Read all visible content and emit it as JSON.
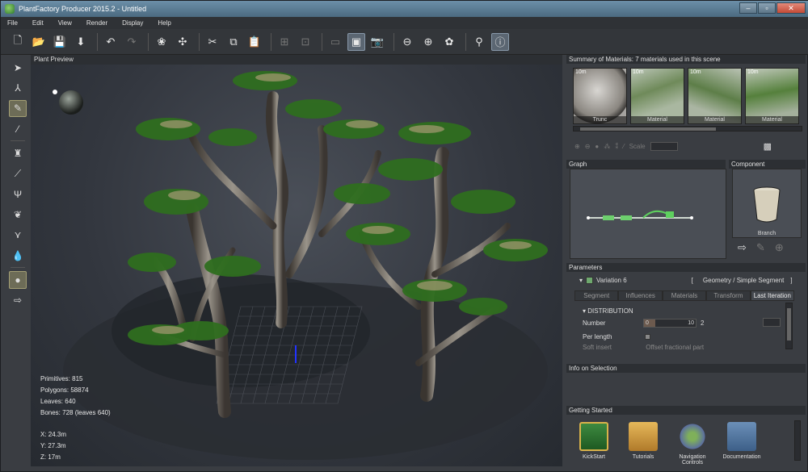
{
  "window": {
    "title": "PlantFactory Producer 2015.2 - Untitled",
    "controls": [
      "–",
      "▫",
      "✕"
    ]
  },
  "menu": [
    "File",
    "Edit",
    "View",
    "Render",
    "Display",
    "Help"
  ],
  "viewport": {
    "header": "Plant Preview",
    "stats": {
      "primitives": "Primitives: 815",
      "polygons": "Polygons: 58874",
      "leaves": "Leaves: 640",
      "bones": "Bones: 728 (leaves 640)"
    },
    "coords": {
      "x": "X: 24.3m",
      "y": "Y: 27.3m",
      "z": "Z: 17m"
    }
  },
  "materials": {
    "header": "Summary of Materials: 7 materials used in this scene",
    "items": [
      {
        "tag": "10m",
        "label": "Trunc"
      },
      {
        "tag": "10m",
        "label": "Material"
      },
      {
        "tag": "10m",
        "label": "Material"
      },
      {
        "tag": "10m",
        "label": "Material"
      }
    ],
    "scale_label": "Scale"
  },
  "graph": {
    "header": "Graph"
  },
  "component": {
    "header": "Component",
    "label": "Branch"
  },
  "parameters": {
    "header": "Parameters",
    "variation": "Variation 6",
    "breadcrumb_open": "[",
    "geometry": "Geometry / Simple Segment",
    "breadcrumb_close": "]",
    "tabs": [
      "Segment",
      "Influences",
      "Materials",
      "Transform",
      "Last Iteration"
    ],
    "section": "DISTRIBUTION",
    "number_label": "Number",
    "number_min": "0",
    "number_max": "10",
    "number_value": "2",
    "per_length_label": "Per length",
    "soft_insert_label": "Soft insert",
    "offset_label": "Offset fractional part"
  },
  "info": {
    "header": "Info on Selection"
  },
  "getting_started": {
    "header": "Getting Started",
    "tiles": [
      "KickStart",
      "Tutorials",
      "Navigation Controls",
      "Documentation"
    ]
  }
}
